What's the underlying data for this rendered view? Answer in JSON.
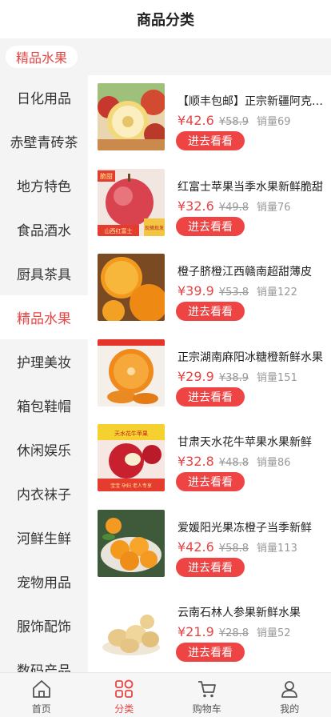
{
  "header": {
    "title": "商品分类"
  },
  "current_category": {
    "label": "精品水果"
  },
  "sidebar": {
    "items": [
      {
        "label": "日化用品",
        "active": false
      },
      {
        "label": "赤壁青砖茶",
        "active": false
      },
      {
        "label": "地方特色",
        "active": false
      },
      {
        "label": "食品酒水",
        "active": false
      },
      {
        "label": "厨具茶具",
        "active": false
      },
      {
        "label": "精品水果",
        "active": true
      },
      {
        "label": "护理美妆",
        "active": false
      },
      {
        "label": "箱包鞋帽",
        "active": false
      },
      {
        "label": "休闲娱乐",
        "active": false
      },
      {
        "label": "内衣袜子",
        "active": false
      },
      {
        "label": "河鲜生鲜",
        "active": false
      },
      {
        "label": "宠物用品",
        "active": false
      },
      {
        "label": "服饰配饰",
        "active": false
      },
      {
        "label": "数码产品",
        "active": false
      }
    ]
  },
  "products": [
    {
      "name": "【顺丰包邮】正宗新疆阿克苏冰糖心苹果",
      "price": "¥42.6",
      "original_price": "¥58.9",
      "sales": "销量69",
      "button": "进去看看",
      "image": "apple-cut"
    },
    {
      "name": "红富士苹果当季水果新鲜脆甜",
      "price": "¥32.6",
      "original_price": "¥49.8",
      "sales": "销量76",
      "button": "进去看看",
      "image": "apple-red",
      "image_text": {
        "badge": "脆甜",
        "caption": "山西红富士",
        "tag": "现摘现发"
      }
    },
    {
      "name": "橙子脐橙江西赣南超甜薄皮",
      "price": "¥39.9",
      "original_price": "¥53.8",
      "sales": "销量122",
      "button": "进去看看",
      "image": "orange-half"
    },
    {
      "name": "正宗湖南麻阳冰糖橙新鲜水果",
      "price": "¥29.9",
      "original_price": "¥38.9",
      "sales": "销量151",
      "button": "进去看看",
      "image": "orange-slice"
    },
    {
      "name": "甘肃天水花牛苹果水果新鲜",
      "price": "¥32.8",
      "original_price": "¥48.8",
      "sales": "销量86",
      "button": "进去看看",
      "image": "apple-promo",
      "image_text": {
        "badge": "天水花牛苹果",
        "caption": "宝宝 孕妇 老人专享"
      }
    },
    {
      "name": "爱媛阳光果冻橙子当季新鲜",
      "price": "¥42.6",
      "original_price": "¥58.8",
      "sales": "销量113",
      "button": "进去看看",
      "image": "orange-pile"
    },
    {
      "name": "云南石林人参果新鲜水果",
      "price": "¥21.9",
      "original_price": "¥28.8",
      "sales": "销量52",
      "button": "进去看看",
      "image": "ginseng-fruit"
    }
  ],
  "tabbar": {
    "items": [
      {
        "label": "首页",
        "icon": "home-icon",
        "active": false
      },
      {
        "label": "分类",
        "icon": "category-icon",
        "active": true
      },
      {
        "label": "购物车",
        "icon": "cart-icon",
        "active": false
      },
      {
        "label": "我的",
        "icon": "user-icon",
        "active": false
      }
    ]
  },
  "colors": {
    "accent": "#e64545",
    "button": "#ef4444",
    "sidebar_bg": "#f4f4f4",
    "muted": "#999999"
  }
}
